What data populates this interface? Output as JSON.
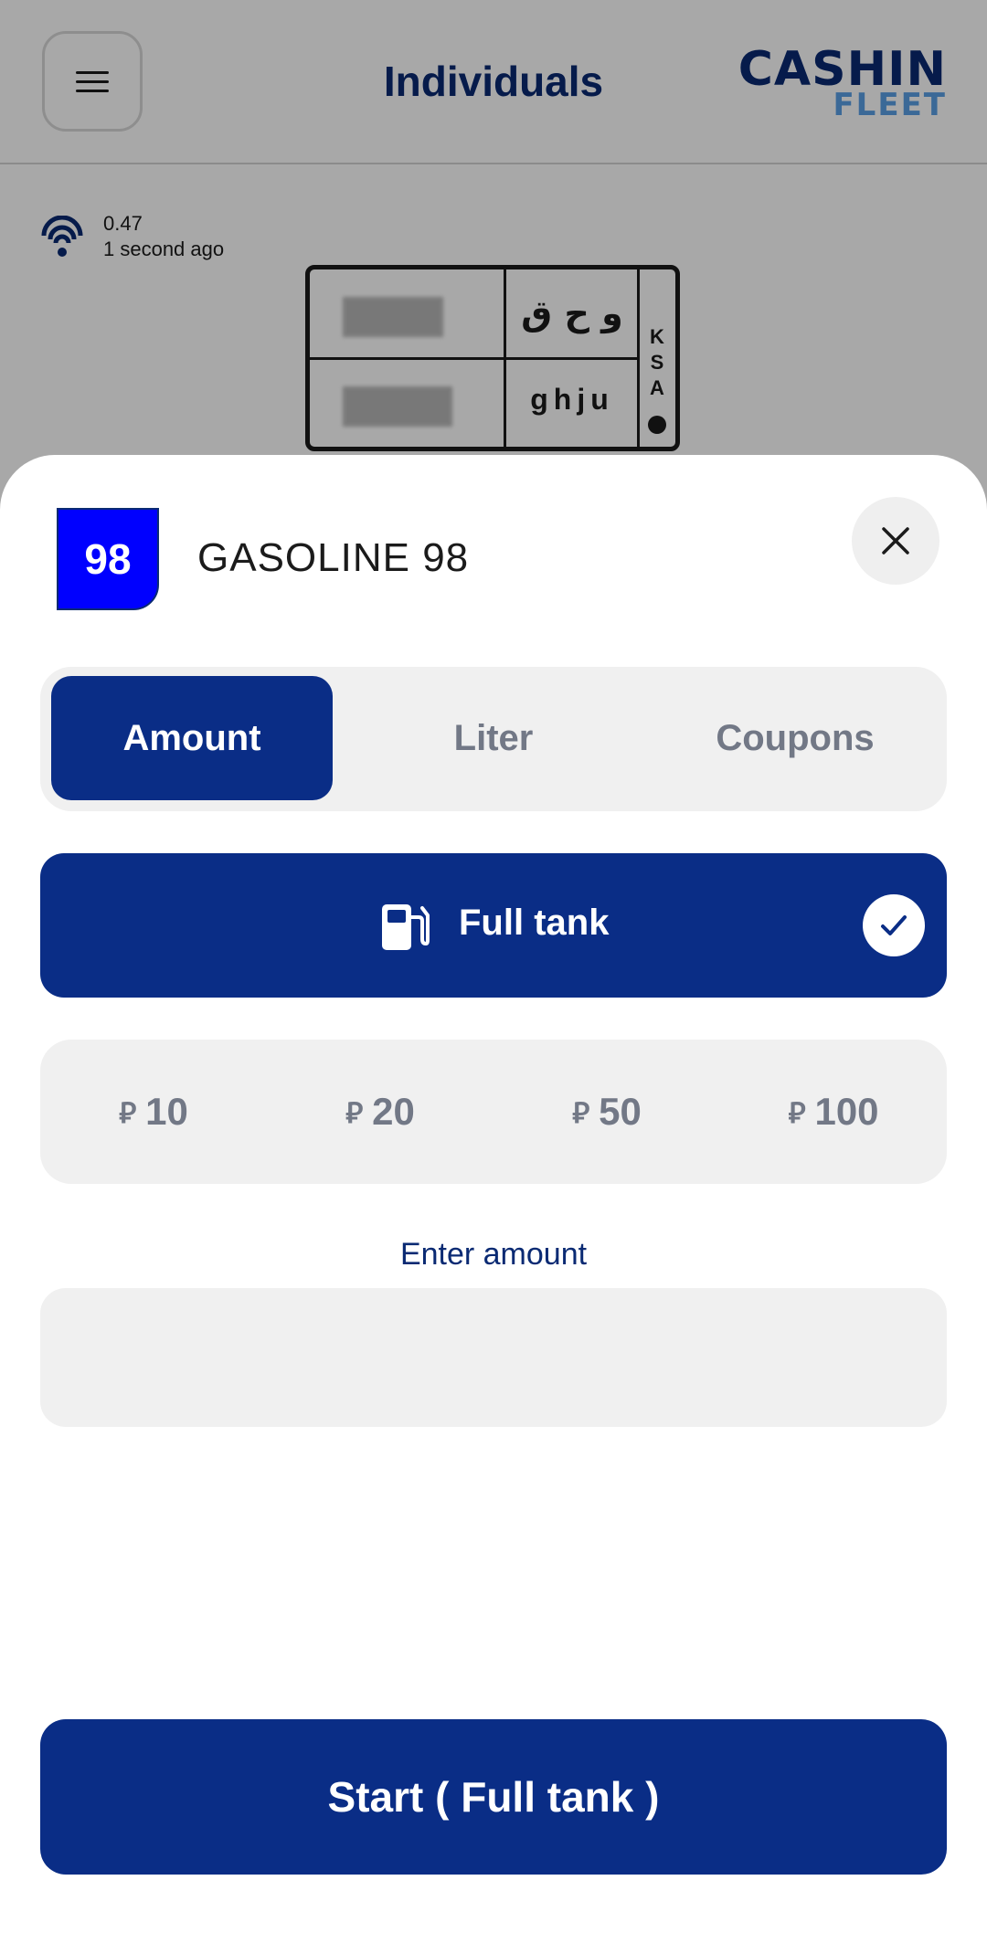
{
  "header": {
    "title": "Individuals",
    "logo_top": "CASHIN",
    "logo_bottom": "FLEET"
  },
  "status": {
    "signal_value": "0.47",
    "updated": "1 second ago"
  },
  "plate": {
    "arabic_letters": "و ح ق",
    "latin_letters": "ghju",
    "country": [
      "K",
      "S",
      "A"
    ]
  },
  "sheet": {
    "fuel_badge": "98",
    "fuel_name": "GASOLINE 98",
    "tabs": [
      {
        "label": "Amount",
        "active": true
      },
      {
        "label": "Liter",
        "active": false
      },
      {
        "label": "Coupons",
        "active": false
      }
    ],
    "full_tank_label": "Full tank",
    "full_tank_selected": true,
    "currency_icon": "riyal-icon",
    "presets": [
      "10",
      "20",
      "50",
      "100"
    ],
    "amount_label": "Enter amount",
    "amount_value": "",
    "start_label": "Start ( Full tank )"
  },
  "colors": {
    "primary": "#0a2d86",
    "fuel_badge": "#0000ff",
    "logo_accent": "#5aa0e6",
    "surface": "#f0f0f0"
  }
}
